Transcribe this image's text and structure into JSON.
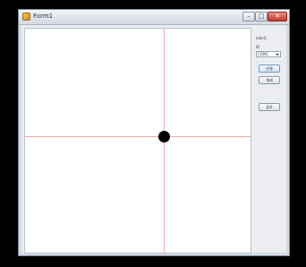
{
  "window": {
    "title": "Form1",
    "controls": {
      "minimize": "–",
      "maximize": "□",
      "close": "✕"
    }
  },
  "panel": {
    "label_top": "label1",
    "label_combo": "ID",
    "combo_value": "COM1",
    "buttons": [
      "연결",
      "해제",
      "종료"
    ]
  },
  "colors": {
    "crosshair": "#f2a9a9",
    "marker": "#000000",
    "canvas": "#ffffff"
  },
  "icons": {
    "app": "app-icon",
    "close": "close-icon",
    "dropdown": "chevron-down-icon"
  }
}
